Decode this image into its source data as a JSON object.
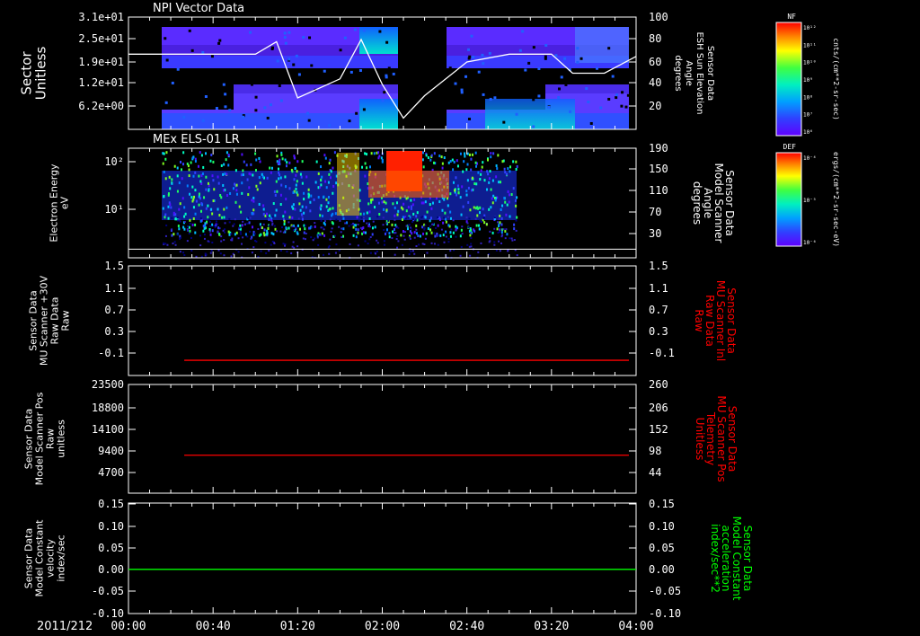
{
  "title_top": "NPI Vector Data",
  "title_second": "MEx ELS-01 LR",
  "date_label": "2011/212",
  "x_ticks": [
    "00:00",
    "00:40",
    "01:20",
    "02:00",
    "02:40",
    "03:20",
    "04:00"
  ],
  "colors": {
    "background": "#000000",
    "axis": "#ffffff",
    "red_trace": "#ff0000",
    "green_trace": "#00ff00",
    "white_trace": "#ffffff"
  },
  "panels": [
    {
      "id": "npi",
      "left_label": [
        "Sector",
        "Unitless"
      ],
      "left_ticks": [
        "3.1e+01",
        "2.5e+01",
        "1.9e+01",
        "1.2e+01",
        "6.2e+00"
      ],
      "right_ticks": [
        "100",
        "80",
        "60",
        "40",
        "20"
      ],
      "right_label": [
        "Sensor Data",
        "ESH Sun Elevation",
        "Angle",
        "degrees"
      ],
      "colorbar": {
        "name": "NF",
        "unit": "cnts/(cm**2-sr-sec)",
        "ticks": [
          "10¹²",
          "10¹¹",
          "10¹⁰",
          "10⁹",
          "10⁸",
          "10⁷",
          "10⁶"
        ]
      }
    },
    {
      "id": "els",
      "left_label": [
        "Electron Energy",
        "eV"
      ],
      "left_ticks": [
        "10²",
        "10¹"
      ],
      "right_ticks": [
        "190",
        "150",
        "110",
        "70",
        "30"
      ],
      "right_label": [
        "Sensor Data",
        "Model Scanner",
        "Angle",
        "degrees"
      ],
      "colorbar": {
        "name": "DEF",
        "unit": "ergs/(cm**2-sr-sec-eV)",
        "ticks": [
          "10⁻⁴",
          "10⁻⁵",
          "10⁻⁶"
        ]
      }
    },
    {
      "id": "mu30",
      "left_label": [
        "Sensor Data",
        "MU Scanner +30V",
        "Raw Data",
        "Raw"
      ],
      "left_ticks": [
        "1.5",
        "1.1",
        "0.7",
        "0.3",
        "-0.1"
      ],
      "right_ticks": [
        "1.5",
        "1.1",
        "0.7",
        "0.3",
        "-0.1"
      ],
      "right_label": [
        "Sensor Data",
        "MU Scanner Inl",
        "Raw Data",
        "Raw"
      ]
    },
    {
      "id": "mupos",
      "left_label": [
        "Sensor Data",
        "Model Scanner Pos",
        "Raw",
        "unitless"
      ],
      "left_ticks": [
        "23500",
        "18800",
        "14100",
        "9400",
        "4700"
      ],
      "right_ticks": [
        "260",
        "206",
        "152",
        "98",
        "44"
      ],
      "right_label": [
        "Sensor Data",
        "MU Scanner Pos",
        "Telemetry",
        "Unitless"
      ]
    },
    {
      "id": "const",
      "left_label": [
        "Sensor Data",
        "Model Constant",
        "velocity",
        "index/sec"
      ],
      "left_ticks": [
        "0.15",
        "0.10",
        "0.05",
        "0.00",
        "-0.05",
        "-0.10"
      ],
      "right_ticks": [
        "0.15",
        "0.10",
        "0.05",
        "0.00",
        "-0.05",
        "-0.10"
      ],
      "right_label": [
        "Sensor Data",
        "Model Constant",
        "acceleration",
        "index/sec**2"
      ]
    }
  ],
  "chart_data": [
    {
      "type": "heatmap",
      "title": "NPI Vector Data",
      "ylabel": "Sector Unitless",
      "y2label": "Sensor Data ESH Sun Elevation Angle degrees",
      "xlim": [
        "00:00",
        "04:00"
      ],
      "ylim": [
        0,
        31
      ],
      "y2lim": [
        0,
        100
      ],
      "series": [
        {
          "name": "ESH Sun Elevation",
          "x": [
            "00:00",
            "00:20",
            "00:40",
            "01:00",
            "01:10",
            "01:20",
            "01:40",
            "01:50",
            "02:00",
            "02:10",
            "02:20",
            "02:40",
            "03:00",
            "03:20",
            "03:30",
            "03:45",
            "04:00"
          ],
          "values": [
            67,
            67,
            67,
            67,
            78,
            28,
            45,
            80,
            40,
            10,
            30,
            60,
            67,
            67,
            50,
            50,
            65
          ]
        }
      ]
    },
    {
      "type": "heatmap",
      "title": "MEx ELS-01 LR",
      "ylabel": "Electron Energy eV",
      "y2label": "Sensor Data Model Scanner Angle degrees",
      "xlim": [
        "00:00",
        "04:00"
      ],
      "y2lim": [
        0,
        190
      ],
      "series": [
        {
          "name": "Model Scanner Angle",
          "x": [
            "00:00",
            "04:00"
          ],
          "values": [
            15,
            15
          ]
        }
      ]
    },
    {
      "type": "line",
      "ylabel": "Sensor Data MU Scanner +30V Raw Data Raw",
      "y2label": "Sensor Data MU Scanner Inl Raw Data Raw",
      "xlim": [
        "00:00",
        "04:00"
      ],
      "ylim": [
        -0.3,
        1.5
      ],
      "series": [
        {
          "name": "MU Scanner Inl",
          "x": [
            "00:20",
            "04:00"
          ],
          "values": [
            -0.05,
            -0.05
          ]
        }
      ]
    },
    {
      "type": "line",
      "ylabel": "Sensor Data Model Scanner Pos Raw unitless",
      "y2label": "Sensor Data MU Scanner Pos Telemetry Unitless",
      "xlim": [
        "00:00",
        "04:00"
      ],
      "ylim": [
        0,
        23500
      ],
      "series": [
        {
          "name": "MU Scanner Pos",
          "x": [
            "00:20",
            "04:00"
          ],
          "values": [
            8200,
            8200
          ]
        }
      ]
    },
    {
      "type": "line",
      "ylabel": "Sensor Data Model Constant velocity index/sec",
      "y2label": "Sensor Data Model Constant acceleration index/sec**2",
      "xlim": [
        "00:00",
        "04:00"
      ],
      "ylim": [
        -0.1,
        0.15
      ],
      "series": [
        {
          "name": "Model Constant",
          "x": [
            "00:00",
            "04:00"
          ],
          "values": [
            0.0,
            0.0
          ]
        }
      ]
    }
  ]
}
